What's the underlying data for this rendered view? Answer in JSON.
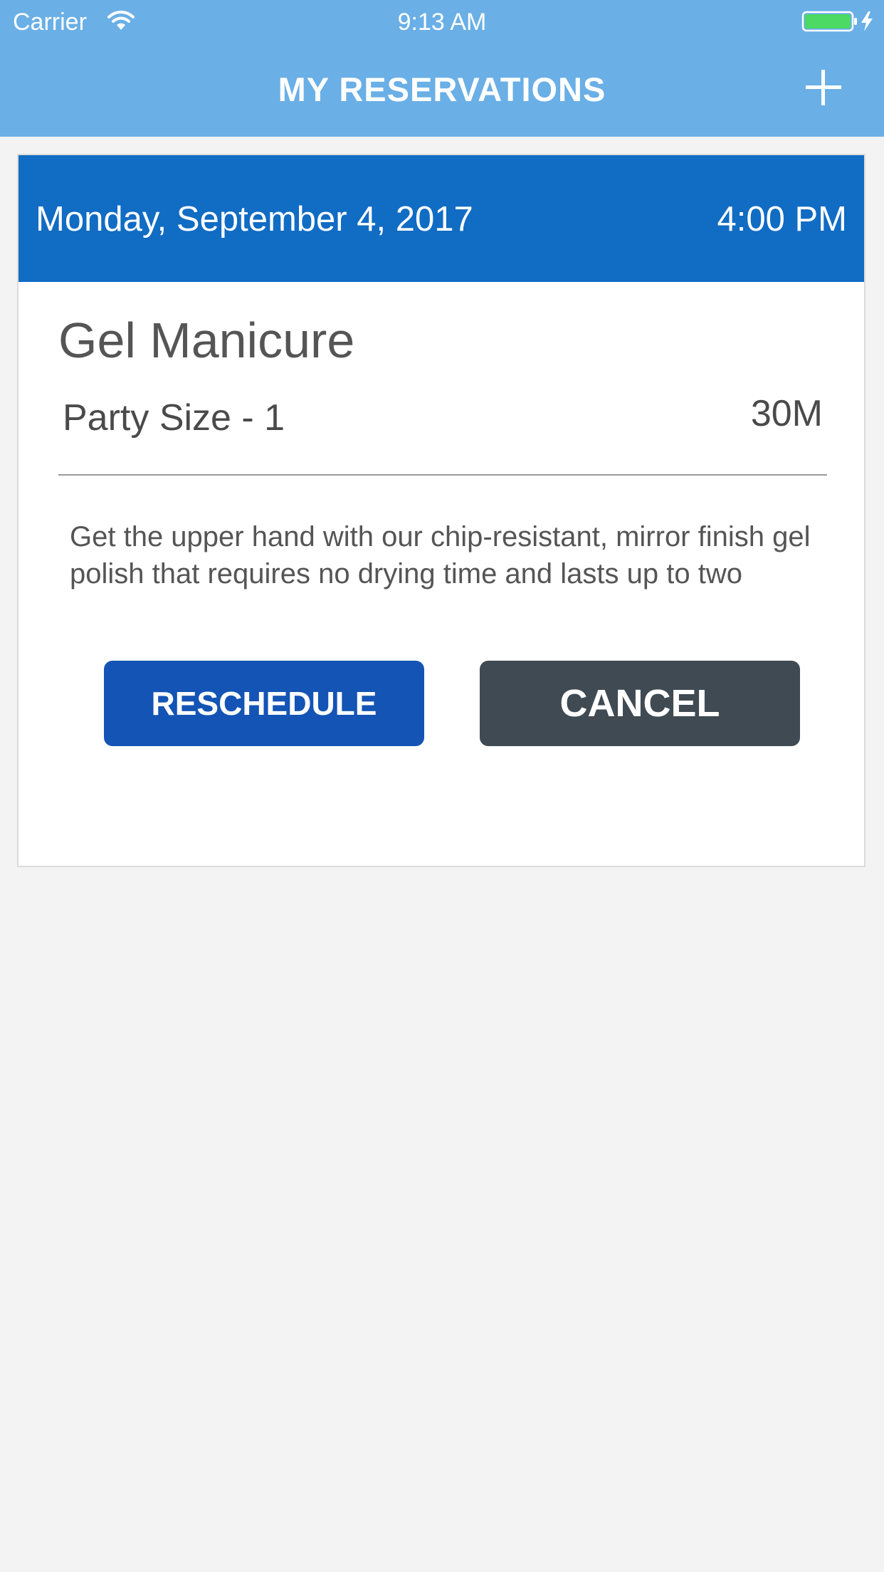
{
  "status_bar": {
    "carrier": "Carrier",
    "time": "9:13 AM",
    "wifi_icon": "wifi-icon",
    "battery_icon": "battery-charging-icon",
    "battery_level": 1.0,
    "battery_color": "#4cd964"
  },
  "nav": {
    "title": "MY RESERVATIONS",
    "add_icon": "plus-icon",
    "background_color": "#6aafe6"
  },
  "reservation": {
    "date": "Monday, September 4, 2017",
    "time": "4:00 PM",
    "service": "Gel Manicure",
    "party_size": "Party Size - 1",
    "duration": "30M",
    "description": "Get the upper hand with our chip-resistant, mirror finish gel polish that requires no drying time and lasts up to two",
    "header_color": "#116cc4",
    "buttons": {
      "reschedule_label": "RESCHEDULE",
      "reschedule_color": "#1354b5",
      "cancel_label": "CANCEL",
      "cancel_color": "#404a52"
    }
  }
}
